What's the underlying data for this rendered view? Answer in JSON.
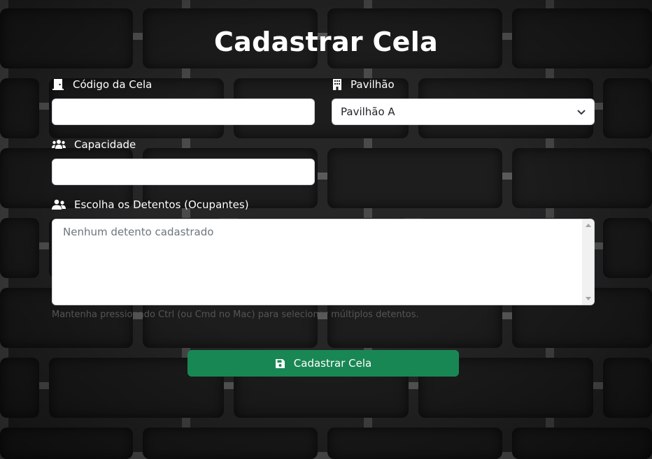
{
  "form": {
    "title": "Cadastrar Cela",
    "codigo": {
      "label": "Código da Cela",
      "icon": "door-icon",
      "value": "",
      "placeholder": ""
    },
    "pavilhao": {
      "label": "Pavilhão",
      "icon": "building-icon",
      "selected": "Pavilhão A"
    },
    "capacidade": {
      "label": "Capacidade",
      "icon": "users-icon",
      "value": "",
      "placeholder": ""
    },
    "detentos": {
      "label": "Escolha os Detentos (Ocupantes)",
      "icon": "user-group-icon",
      "placeholder": "Nenhum detento cadastrado"
    },
    "help_text": "Mantenha pressionado Ctrl (ou Cmd no Mac) para selecionar múltiplos detentos.",
    "submit": {
      "label": "Cadastrar Cela",
      "icon": "save-icon",
      "color": "#198754"
    }
  }
}
